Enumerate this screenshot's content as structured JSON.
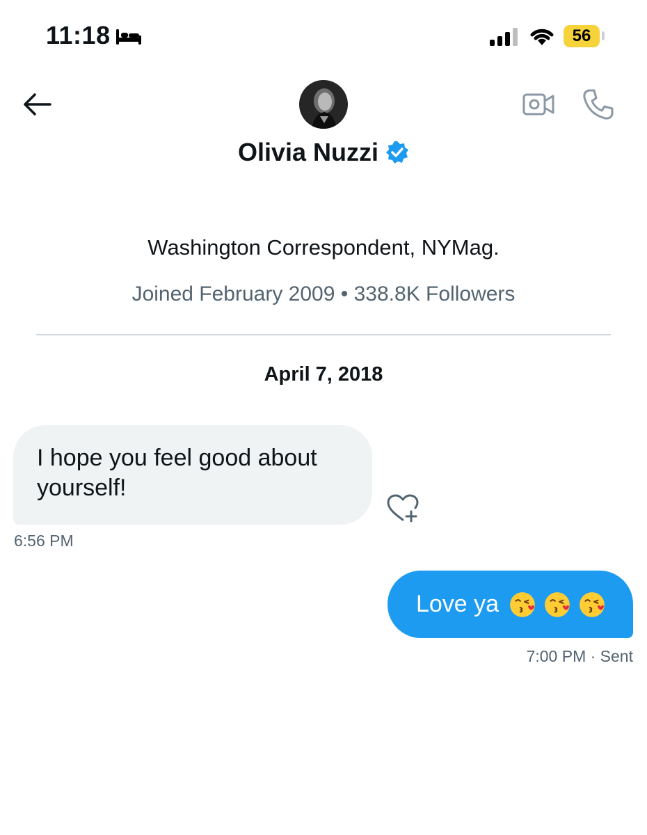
{
  "status_bar": {
    "time": "11:18",
    "battery": "56",
    "battery_color": "#f6d23b"
  },
  "header": {
    "name": "Olivia Nuzzi",
    "verified_color": "#1d9bf0",
    "icons": [
      "back-arrow-icon",
      "avatar",
      "video-call-icon",
      "phone-call-icon"
    ]
  },
  "profile": {
    "bio": "Washington Correspondent, NYMag.",
    "joined": "Joined February 2009",
    "separator": "•",
    "followers": "338.8K Followers"
  },
  "conversation": {
    "date": "April 7, 2018",
    "messages": [
      {
        "direction": "received",
        "text": "I hope you feel good about yourself!",
        "time": "6:56 PM"
      },
      {
        "direction": "sent",
        "text": "Love ya",
        "emoji_count": 3,
        "emoji_name": "face-blowing-a-kiss",
        "time": "7:00 PM",
        "status": "· Sent"
      }
    ]
  },
  "colors": {
    "accent": "#1d9bf0",
    "received_bubble": "#eff3f4",
    "secondary_text": "#536471"
  }
}
